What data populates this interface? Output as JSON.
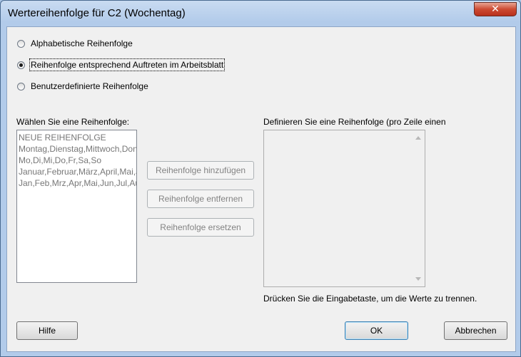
{
  "window": {
    "title": "Wertereihenfolge für C2 (Wochentag)",
    "close_glyph": "✕"
  },
  "order_options": [
    {
      "label": "Alphabetische Reihenfolge",
      "checked": false
    },
    {
      "label": "Reihenfolge entsprechend Auftreten im Arbeitsblatt",
      "checked": true
    },
    {
      "label": "Benutzerdefinierte Reihenfolge",
      "checked": false
    }
  ],
  "select_order": {
    "label": "Wählen Sie eine Reihenfolge:",
    "items": [
      "NEUE REIHENFOLGE",
      "Montag,Dienstag,Mittwoch,Donnerstag,Freitag,Samstag,Sonntag",
      "Mo,Di,Mi,Do,Fr,Sa,So",
      "Januar,Februar,März,April,Mai,Juni,Juli,August,September,Oktober,November,Dezember",
      "Jan,Feb,Mrz,Apr,Mai,Jun,Jul,Aug,Sep,Okt,Nov,Dez"
    ]
  },
  "actions": {
    "add": "Reihenfolge hinzufügen",
    "remove": "Reihenfolge entfernen",
    "replace": "Reihenfolge ersetzen"
  },
  "define_order": {
    "label": "Definieren Sie eine Reihenfolge (pro Zeile einen",
    "value": "",
    "hint": "Drücken Sie die Eingabetaste, um die Werte zu trennen."
  },
  "footer": {
    "help": "Hilfe",
    "ok": "OK",
    "cancel": "Abbrechen"
  }
}
